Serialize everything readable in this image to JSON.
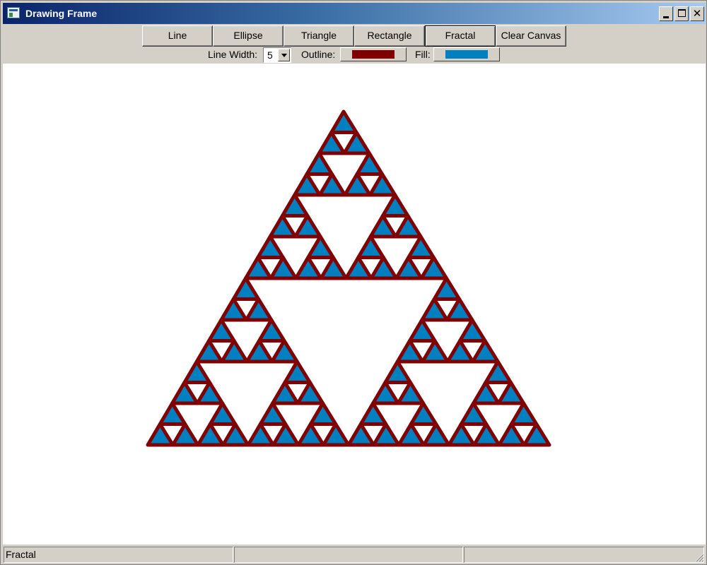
{
  "window": {
    "title": "Drawing Frame",
    "icon": "app-window-icon",
    "controls": [
      "minimize-icon",
      "maximize-icon",
      "close-icon"
    ],
    "close_glyph": "✕"
  },
  "toolbar": {
    "shape_buttons": [
      {
        "label": "Line",
        "active": false
      },
      {
        "label": "Ellipse",
        "active": false
      },
      {
        "label": "Triangle",
        "active": false
      },
      {
        "label": "Rectangle",
        "active": false
      },
      {
        "label": "Fractal",
        "active": true
      },
      {
        "label": "Clear Canvas",
        "active": false
      }
    ],
    "line_width_label": "Line Width:",
    "line_width_value": "5",
    "outline_label": "Outline:",
    "outline_color": "#800000",
    "fill_label": "Fill:",
    "fill_color": "#0080c0"
  },
  "canvas": {
    "background": "#ffffff",
    "drawing": "sierpinski-triangle",
    "depth": 4
  },
  "statusbar": {
    "panes": [
      "Fractal",
      "",
      ""
    ]
  }
}
